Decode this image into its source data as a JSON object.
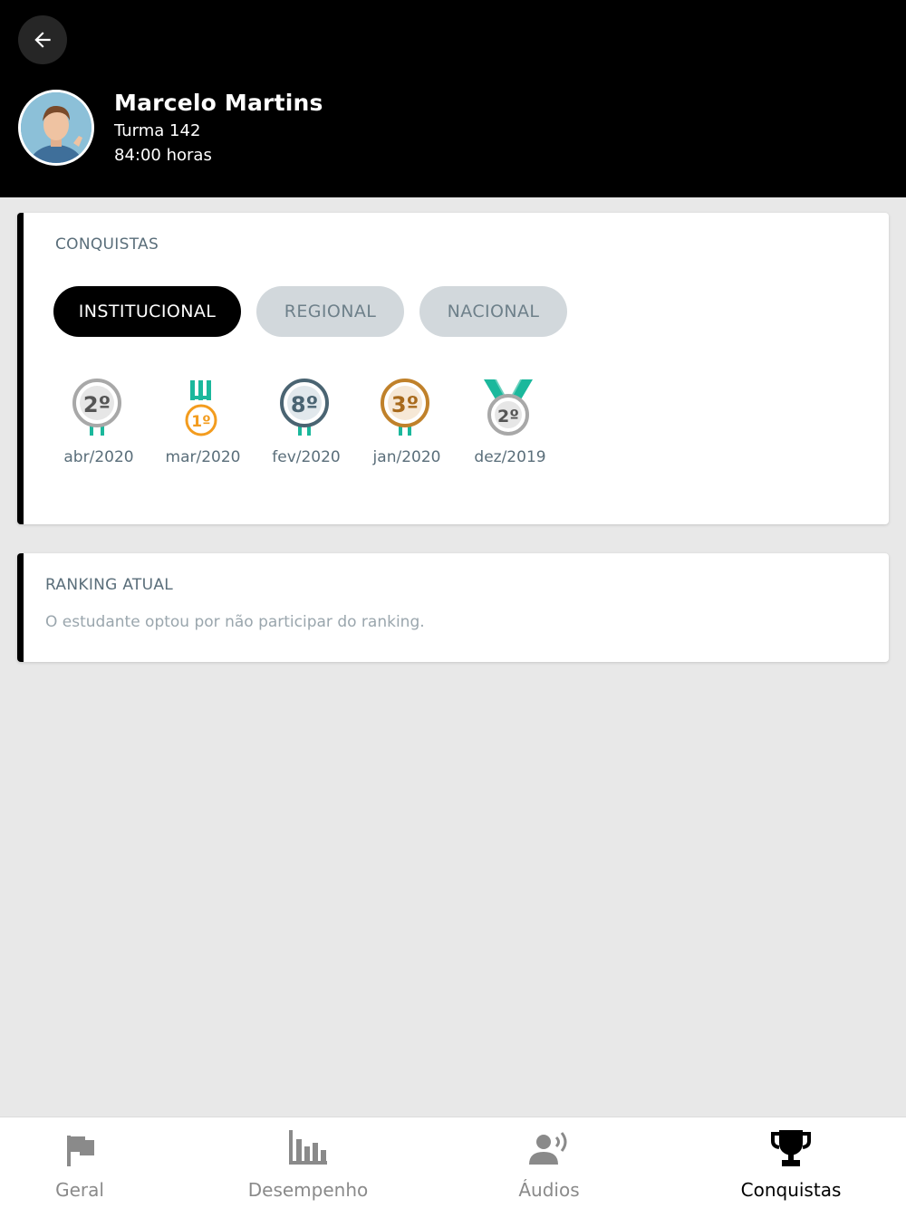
{
  "header": {
    "name": "Marcelo Martins",
    "class": "Turma 142",
    "hours": "84:00 horas"
  },
  "icons": {
    "back": "arrow-left-icon",
    "avatar": "student-photo"
  },
  "conquistas": {
    "title": "CONQUISTAS",
    "tabs": [
      {
        "label": "INSTITUCIONAL",
        "active": true
      },
      {
        "label": "REGIONAL",
        "active": false
      },
      {
        "label": "NACIONAL",
        "active": false
      }
    ],
    "medals": [
      {
        "place": "2º",
        "label": "abr/2020",
        "color": "#a8a8a8"
      },
      {
        "place": "1º",
        "label": "mar/2020",
        "color": "#f39c1e"
      },
      {
        "place": "8º",
        "label": "fev/2020",
        "color": "#4a6472"
      },
      {
        "place": "3º",
        "label": "jan/2020",
        "color": "#c0812a"
      },
      {
        "place": "2º",
        "label": "dez/2019",
        "color": "#a8a8a8"
      }
    ]
  },
  "ranking": {
    "title": "RANKING ATUAL",
    "message": "O estudante optou por não participar do ranking."
  },
  "nav": {
    "items": [
      {
        "label": "Geral",
        "icon": "flag-icon",
        "active": false
      },
      {
        "label": "Desempenho",
        "icon": "bar-chart-icon",
        "active": false
      },
      {
        "label": "Áudios",
        "icon": "speaking-person-icon",
        "active": false
      },
      {
        "label": "Conquistas",
        "icon": "trophy-icon",
        "active": true
      }
    ]
  },
  "colors": {
    "accent": "#000000",
    "ribbon": "#1bb89c",
    "tab_inactive_bg": "#d2d8dc"
  }
}
